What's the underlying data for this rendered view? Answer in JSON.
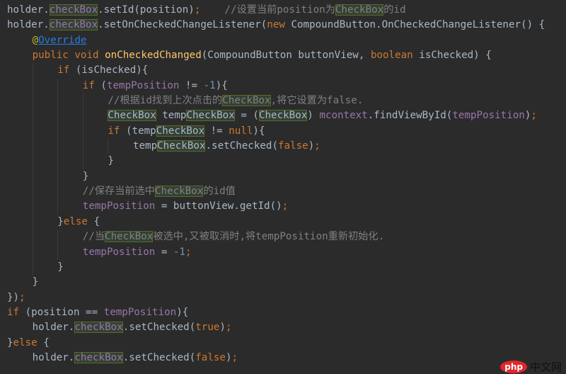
{
  "colors": {
    "background": "#2b2b2b",
    "text": "#a9b7c6",
    "keyword": "#cc7832",
    "field": "#9876aa",
    "method": "#ffc66d",
    "comment": "#808080",
    "annotation": "#bbb529",
    "highlight": "#344134"
  },
  "watermark": {
    "logo": "php",
    "text": "中文网"
  },
  "lines": [
    {
      "indent": 0,
      "tokens": [
        [
          "p",
          "holder."
        ],
        [
          "fld",
          "checkBox",
          1
        ],
        [
          "p",
          ".setId(position)"
        ],
        [
          "kw",
          ";"
        ],
        [
          "cmt",
          "    //设置当前position为"
        ],
        [
          "cmt",
          "CheckBox",
          1
        ],
        [
          "cmt",
          "的id"
        ]
      ]
    },
    {
      "indent": 0,
      "tokens": [
        [
          "p",
          "holder."
        ],
        [
          "fld",
          "checkBox",
          1
        ],
        [
          "p",
          ".setOnCheckedChangeListener("
        ],
        [
          "kw",
          "new"
        ],
        [
          "p",
          " CompoundButton.OnCheckedChangeListener() {"
        ]
      ]
    },
    {
      "indent": 1,
      "tokens": [
        [
          "ann",
          "@"
        ],
        [
          "lnk",
          "Override"
        ]
      ]
    },
    {
      "indent": 1,
      "tokens": [
        [
          "kw",
          "public void "
        ],
        [
          "mth",
          "onCheckedChanged"
        ],
        [
          "p",
          "(CompoundButton buttonView, "
        ],
        [
          "kw",
          "boolean"
        ],
        [
          "p",
          " isChecked) {"
        ]
      ]
    },
    {
      "indent": 2,
      "tokens": [
        [
          "kw",
          "if"
        ],
        [
          "p",
          " (isChecked){"
        ]
      ]
    },
    {
      "indent": 3,
      "tokens": [
        [
          "kw",
          "if"
        ],
        [
          "p",
          " ("
        ],
        [
          "fld",
          "tempPosition"
        ],
        [
          "p",
          " != "
        ],
        [
          "num",
          "-1"
        ],
        [
          "p",
          "){"
        ]
      ]
    },
    {
      "indent": 4,
      "tokens": [
        [
          "cmt",
          "//根据id找到上次点击的"
        ],
        [
          "cmt",
          "CheckBox",
          1
        ],
        [
          "cmt",
          ",将它设置为false."
        ]
      ]
    },
    {
      "indent": 4,
      "tokens": [
        [
          "p",
          "CheckBox",
          1
        ],
        [
          "p",
          " temp"
        ],
        [
          "p",
          "CheckBox",
          1
        ],
        [
          "p",
          " = ("
        ],
        [
          "p",
          "CheckBox",
          1
        ],
        [
          "p",
          ") "
        ],
        [
          "fld",
          "mcontext"
        ],
        [
          "p",
          ".findViewById("
        ],
        [
          "fld",
          "tempPosition"
        ],
        [
          "p",
          ")"
        ],
        [
          "kw",
          ";"
        ]
      ]
    },
    {
      "indent": 4,
      "tokens": [
        [
          "kw",
          "if"
        ],
        [
          "p",
          " (temp"
        ],
        [
          "p",
          "CheckBox",
          1
        ],
        [
          "p",
          " != "
        ],
        [
          "kw",
          "null"
        ],
        [
          "p",
          "){"
        ]
      ]
    },
    {
      "indent": 5,
      "tokens": [
        [
          "p",
          "temp"
        ],
        [
          "p",
          "CheckBox",
          1
        ],
        [
          "p",
          ".setChecked("
        ],
        [
          "kw",
          "false"
        ],
        [
          "p",
          ")"
        ],
        [
          "kw",
          ";"
        ]
      ]
    },
    {
      "indent": 4,
      "tokens": [
        [
          "p",
          "}"
        ]
      ]
    },
    {
      "indent": 3,
      "tokens": [
        [
          "p",
          "}"
        ]
      ]
    },
    {
      "indent": 3,
      "tokens": [
        [
          "cmt",
          "//保存当前选中"
        ],
        [
          "cmt",
          "CheckBox",
          1
        ],
        [
          "cmt",
          "的id值"
        ]
      ]
    },
    {
      "indent": 3,
      "tokens": [
        [
          "fld",
          "tempPosition"
        ],
        [
          "p",
          " = buttonView.getId()"
        ],
        [
          "kw",
          ";"
        ]
      ]
    },
    {
      "indent": 2,
      "tokens": [
        [
          "p",
          "}"
        ],
        [
          "kw",
          "else"
        ],
        [
          "p",
          " {"
        ]
      ]
    },
    {
      "indent": 3,
      "tokens": [
        [
          "cmt",
          "//当"
        ],
        [
          "cmt",
          "CheckBox",
          1
        ],
        [
          "cmt",
          "被选中,又被取消时,将tempPosition重新初始化."
        ]
      ]
    },
    {
      "indent": 3,
      "tokens": [
        [
          "fld",
          "tempPosition"
        ],
        [
          "p",
          " = "
        ],
        [
          "num",
          "-1"
        ],
        [
          "kw",
          ";"
        ]
      ]
    },
    {
      "indent": 2,
      "tokens": [
        [
          "p",
          "}"
        ]
      ]
    },
    {
      "indent": 1,
      "tokens": [
        [
          "p",
          "}"
        ]
      ]
    },
    {
      "indent": 0,
      "tokens": [
        [
          "p",
          "})"
        ],
        [
          "kw",
          ";"
        ]
      ]
    },
    {
      "indent": 0,
      "tokens": [
        [
          "kw",
          "if"
        ],
        [
          "p",
          " (position == "
        ],
        [
          "fld",
          "tempPosition"
        ],
        [
          "p",
          "){"
        ]
      ]
    },
    {
      "indent": 1,
      "tokens": [
        [
          "p",
          "holder."
        ],
        [
          "fld",
          "checkBox",
          1
        ],
        [
          "p",
          ".setChecked("
        ],
        [
          "kw",
          "true"
        ],
        [
          "p",
          ")"
        ],
        [
          "kw",
          ";"
        ]
      ]
    },
    {
      "indent": 0,
      "tokens": [
        [
          "p",
          "}"
        ],
        [
          "kw",
          "else"
        ],
        [
          "p",
          " {"
        ]
      ]
    },
    {
      "indent": 1,
      "tokens": [
        [
          "p",
          "holder."
        ],
        [
          "fld",
          "checkBox",
          1
        ],
        [
          "p",
          ".setChecked("
        ],
        [
          "kw",
          "false"
        ],
        [
          "p",
          ")"
        ],
        [
          "kw",
          ";"
        ]
      ]
    }
  ]
}
